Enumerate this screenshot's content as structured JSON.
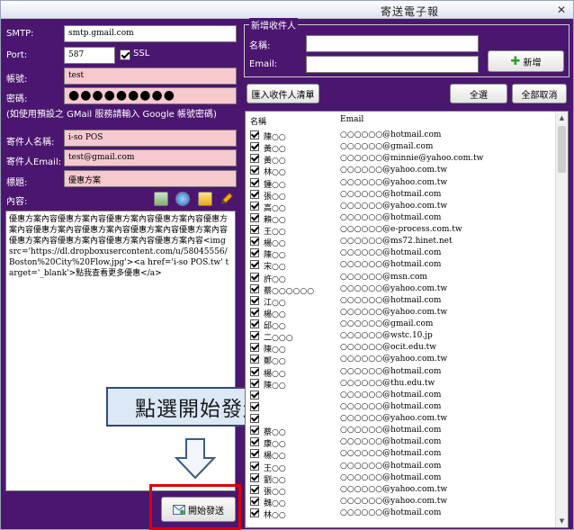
{
  "window": {
    "title": "寄送電子報",
    "close": "✕"
  },
  "form": {
    "smtp_label": "SMTP:",
    "smtp_value": "smtp.gmail.com",
    "port_label": "Port:",
    "port_value": "587",
    "ssl_label": "SSL",
    "ssl_checked": true,
    "account_label": "帳號:",
    "account_value": "test",
    "password_label": "密碼:",
    "password_value": "●●●●●●●●●",
    "note": "(如使用預設之 GMail 服務請輸入 Google 帳號密碼)",
    "sender_name_label": "寄件人名稱:",
    "sender_name_value": "i-so POS",
    "sender_email_label": "寄件人Email:",
    "sender_email_value": "test@gmail.com",
    "subject_label": "標題:",
    "subject_value": "優惠方案",
    "content_label": "內容:",
    "content_value": "優惠方案內容優惠方案內容優惠方案內容優惠方案內容優惠方案內容優惠方案內容優惠方案內容優惠方案內容優惠方案內容優惠方案內容優惠方案內容優惠方案內容優惠方案內容<img src='https://dl.dropboxusercontent.com/u/58045556/Boston%20City%20Flow.jpg'><a href='i-so POS.tw' target='_blank'>點我查看更多優惠</a>",
    "toolbar_icons": [
      "image-icon",
      "globe-icon",
      "folder-icon",
      "pencil-icon"
    ]
  },
  "send_button_label": "開始發送",
  "callout_text": "點選開始發送",
  "recipient": {
    "group_title": "新增收件人",
    "name_label": "名稱:",
    "email_label": "Email:",
    "name_value": "",
    "email_value": "",
    "add_button": "新增",
    "import_button": "匯入收件人清單",
    "select_all_button": "全選",
    "deselect_all_button": "全部取消"
  },
  "list": {
    "columns": [
      "名稱",
      "Email"
    ],
    "rows": [
      {
        "name": "陳○○",
        "email": "○○○○○○@hotmail.com"
      },
      {
        "name": "黃○○",
        "email": "○○○○○○@gmail.com"
      },
      {
        "name": "黃○○",
        "email": "○○○○○○@minnie@yahoo.com.tw"
      },
      {
        "name": "林○○",
        "email": "○○○○○○@yahoo.com.tw"
      },
      {
        "name": "鍾○○",
        "email": "○○○○○○@yahoo.com.tw"
      },
      {
        "name": "張○○",
        "email": "○○○○○○@hotmail.com"
      },
      {
        "name": "高○○",
        "email": "○○○○○○@yahoo.com.tw"
      },
      {
        "name": "賴○○",
        "email": "○○○○○○@hotmail.com"
      },
      {
        "name": "王○○",
        "email": "○○○○○○@e-process.com.tw"
      },
      {
        "name": "楊○○",
        "email": "○○○○○○@ms72.hinet.net"
      },
      {
        "name": "陳○○",
        "email": "○○○○○○@hotmail.com"
      },
      {
        "name": "宋○○",
        "email": "○○○○○○@hotmail.com"
      },
      {
        "name": "許○○",
        "email": "○○○○○○@msn.com"
      },
      {
        "name": "蔡○○○○○○",
        "email": "○○○○○○@yahoo.com.tw"
      },
      {
        "name": "江○○",
        "email": "○○○○○○@hotmail.com"
      },
      {
        "name": "楊○○",
        "email": "○○○○○○@yahoo.com.tw"
      },
      {
        "name": "邱○○",
        "email": "○○○○○○@gmail.com"
      },
      {
        "name": "二○○○",
        "email": "○○○○○○@wstc.10.jp"
      },
      {
        "name": "陳○○",
        "email": "○○○○○○@ocit.edu.tw"
      },
      {
        "name": "鄭○○",
        "email": "○○○○○○@yahoo.com.tw"
      },
      {
        "name": "楊○○",
        "email": "○○○○○○@hotmail.com"
      },
      {
        "name": "陳○○",
        "email": "○○○○○○@thu.edu.tw"
      },
      {
        "name": "",
        "email": "○○○○○○@hotmail.com"
      },
      {
        "name": "",
        "email": "○○○○○○@hotmail.com"
      },
      {
        "name": "",
        "email": "○○○○○○@yahoo.com.tw"
      },
      {
        "name": "蔡○○",
        "email": "○○○○○○@hotmail.com"
      },
      {
        "name": "康○○",
        "email": "○○○○○○@hotmail.com"
      },
      {
        "name": "楊○○",
        "email": "○○○○○○@hotmail.com"
      },
      {
        "name": "王○○",
        "email": "○○○○○○@hotmail.com"
      },
      {
        "name": "劉○○",
        "email": "○○○○○○@hotmail.com"
      },
      {
        "name": "張○○",
        "email": "○○○○○○@yahoo.com.tw"
      },
      {
        "name": "魏○○",
        "email": "○○○○○○@yahoo.com.tw"
      },
      {
        "name": "林○○",
        "email": "○○○○○○@hotmail.com"
      }
    ]
  },
  "colors": {
    "panel_bg": "#4b1670",
    "field_pink": "#f6c9cf",
    "highlight_red": "#e00000",
    "callout_bg": "#dce8f6"
  }
}
